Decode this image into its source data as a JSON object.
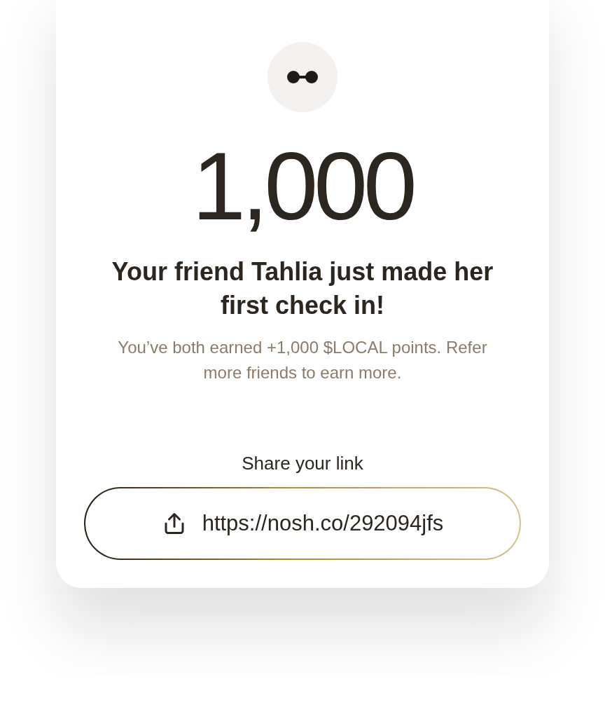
{
  "points": "1,000",
  "heading": "Your friend Tahlia just made her first check in!",
  "message": "You’ve both earned +1,000 $LOCAL points. Refer more friends to earn more.",
  "share": {
    "label": "Share your link",
    "link": "https://nosh.co/292094jfs"
  }
}
